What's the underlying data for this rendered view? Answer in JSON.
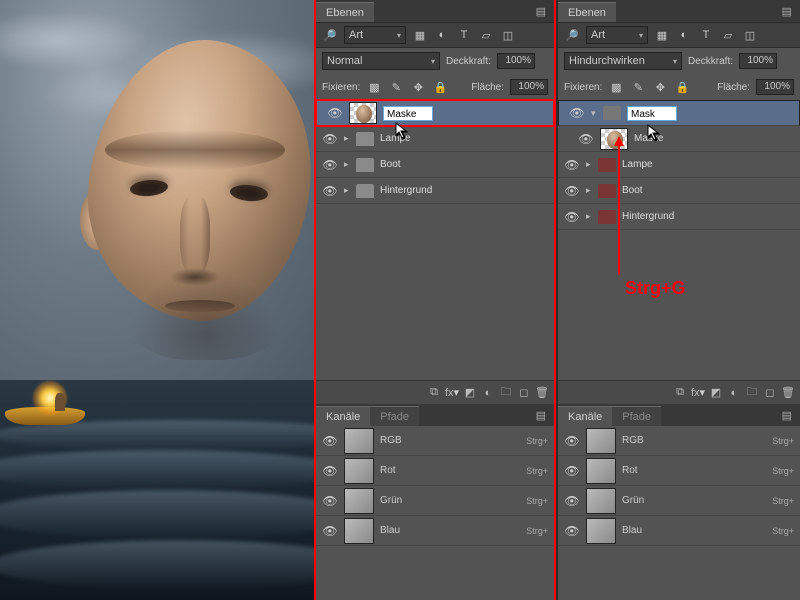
{
  "panelA": {
    "tab": "Ebenen",
    "filter_label": "Art",
    "blend_mode": "Normal",
    "opacity_label": "Deckkraft:",
    "opacity_value": "100%",
    "lock_label": "Fixieren:",
    "fill_label": "Fläche:",
    "fill_value": "100%",
    "rename_value": "Maske",
    "layers": [
      {
        "name": "Lampe"
      },
      {
        "name": "Boot"
      },
      {
        "name": "Hintergrund"
      }
    ]
  },
  "panelB": {
    "tab": "Ebenen",
    "filter_label": "Art",
    "blend_mode": "Hindurchwirken",
    "opacity_label": "Deckkraft:",
    "opacity_value": "100%",
    "lock_label": "Fixieren:",
    "fill_label": "Fläche:",
    "fill_value": "100%",
    "group_rename": "Mask",
    "layers": [
      {
        "name": "Maske"
      },
      {
        "name": "Lampe"
      },
      {
        "name": "Boot"
      },
      {
        "name": "Hintergrund"
      }
    ]
  },
  "channels": {
    "tab_active": "Kanäle",
    "tab_inactive": "Pfade",
    "items": [
      {
        "name": "RGB",
        "shortcut": "Strg+"
      },
      {
        "name": "Rot",
        "shortcut": "Strg+"
      },
      {
        "name": "Grün",
        "shortcut": "Strg+"
      },
      {
        "name": "Blau",
        "shortcut": "Strg+"
      }
    ]
  },
  "annotation": "Strg+G",
  "icons": {
    "eye": "👁",
    "menu": "≡",
    "search": "🔍",
    "link": "⛓",
    "fx": "fx",
    "mask": "■",
    "adj": "◐",
    "folder": "▥",
    "new": "◻",
    "trash": "🗑"
  }
}
